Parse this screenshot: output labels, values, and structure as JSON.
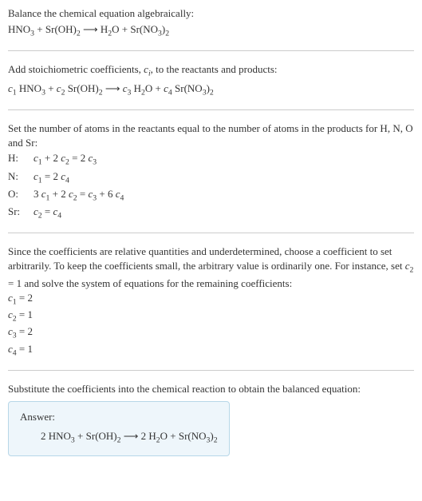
{
  "s1": {
    "title": "Balance the chemical equation algebraically:",
    "eq_pre": "HNO",
    "eq_sub1": "3",
    "eq_mid1": " + Sr(OH)",
    "eq_sub2": "2",
    "eq_arrow": "  ⟶  H",
    "eq_sub3": "2",
    "eq_mid2": "O + Sr(NO",
    "eq_sub4": "3",
    "eq_mid3": ")",
    "eq_sub5": "2"
  },
  "s2": {
    "title_pre": "Add stoichiometric coefficients, ",
    "title_ci_c": "c",
    "title_ci_i": "i",
    "title_post": ", to the reactants and products:",
    "c1c": "c",
    "c1n": "1",
    "t1a": " HNO",
    "t1s": "3",
    "t1b": " + ",
    "c2c": "c",
    "c2n": "2",
    "t2a": " Sr(OH)",
    "t2s": "2",
    "arr": "  ⟶  ",
    "c3c": "c",
    "c3n": "3",
    "t3a": " H",
    "t3s": "2",
    "t3b": "O + ",
    "c4c": "c",
    "c4n": "4",
    "t4a": " Sr(NO",
    "t4s1": "3",
    "t4b": ")",
    "t4s2": "2"
  },
  "s3": {
    "title": "Set the number of atoms in the reactants equal to the number of atoms in the products for H, N, O and Sr:",
    "rows": {
      "H": {
        "label": "H:",
        "a": "c",
        "an": "1",
        "b": " + 2 ",
        "c": "c",
        "cn": "2",
        "d": " = 2 ",
        "e": "c",
        "en": "3"
      },
      "N": {
        "label": "N:",
        "a": "c",
        "an": "1",
        "b": " = 2 ",
        "c": "c",
        "cn": "4"
      },
      "O": {
        "label": "O:",
        "a": "3 ",
        "b": "c",
        "bn": "1",
        "c": " + 2 ",
        "d": "c",
        "dn": "2",
        "e": " = ",
        "f": "c",
        "fn": "3",
        "g": " + 6 ",
        "h": "c",
        "hn": "4"
      },
      "Sr": {
        "label": "Sr:",
        "a": "c",
        "an": "2",
        "b": " = ",
        "c": "c",
        "cn": "4"
      }
    }
  },
  "s4": {
    "p1": "Since the coefficients are relative quantities and underdetermined, choose a coefficient to set arbitrarily. To keep the coefficients small, the arbitrary value is ordinarily one. For instance, set ",
    "setc": "c",
    "setn": "2",
    "p2": " = 1 and solve the system of equations for the remaining coefficients:",
    "lines": {
      "l1": {
        "c": "c",
        "n": "1",
        "v": " = 2"
      },
      "l2": {
        "c": "c",
        "n": "2",
        "v": " = 1"
      },
      "l3": {
        "c": "c",
        "n": "3",
        "v": " = 2"
      },
      "l4": {
        "c": "c",
        "n": "4",
        "v": " = 1"
      }
    }
  },
  "s5": {
    "title": "Substitute the coefficients into the chemical reaction to obtain the balanced equation:",
    "answer_label": "Answer:",
    "a": "2 HNO",
    "as1": "3",
    "b": " + Sr(OH)",
    "bs1": "2",
    "arr": "  ⟶  2 H",
    "cs1": "2",
    "c": "O + Sr(NO",
    "ds1": "3",
    "d": ")",
    "ds2": "2"
  }
}
